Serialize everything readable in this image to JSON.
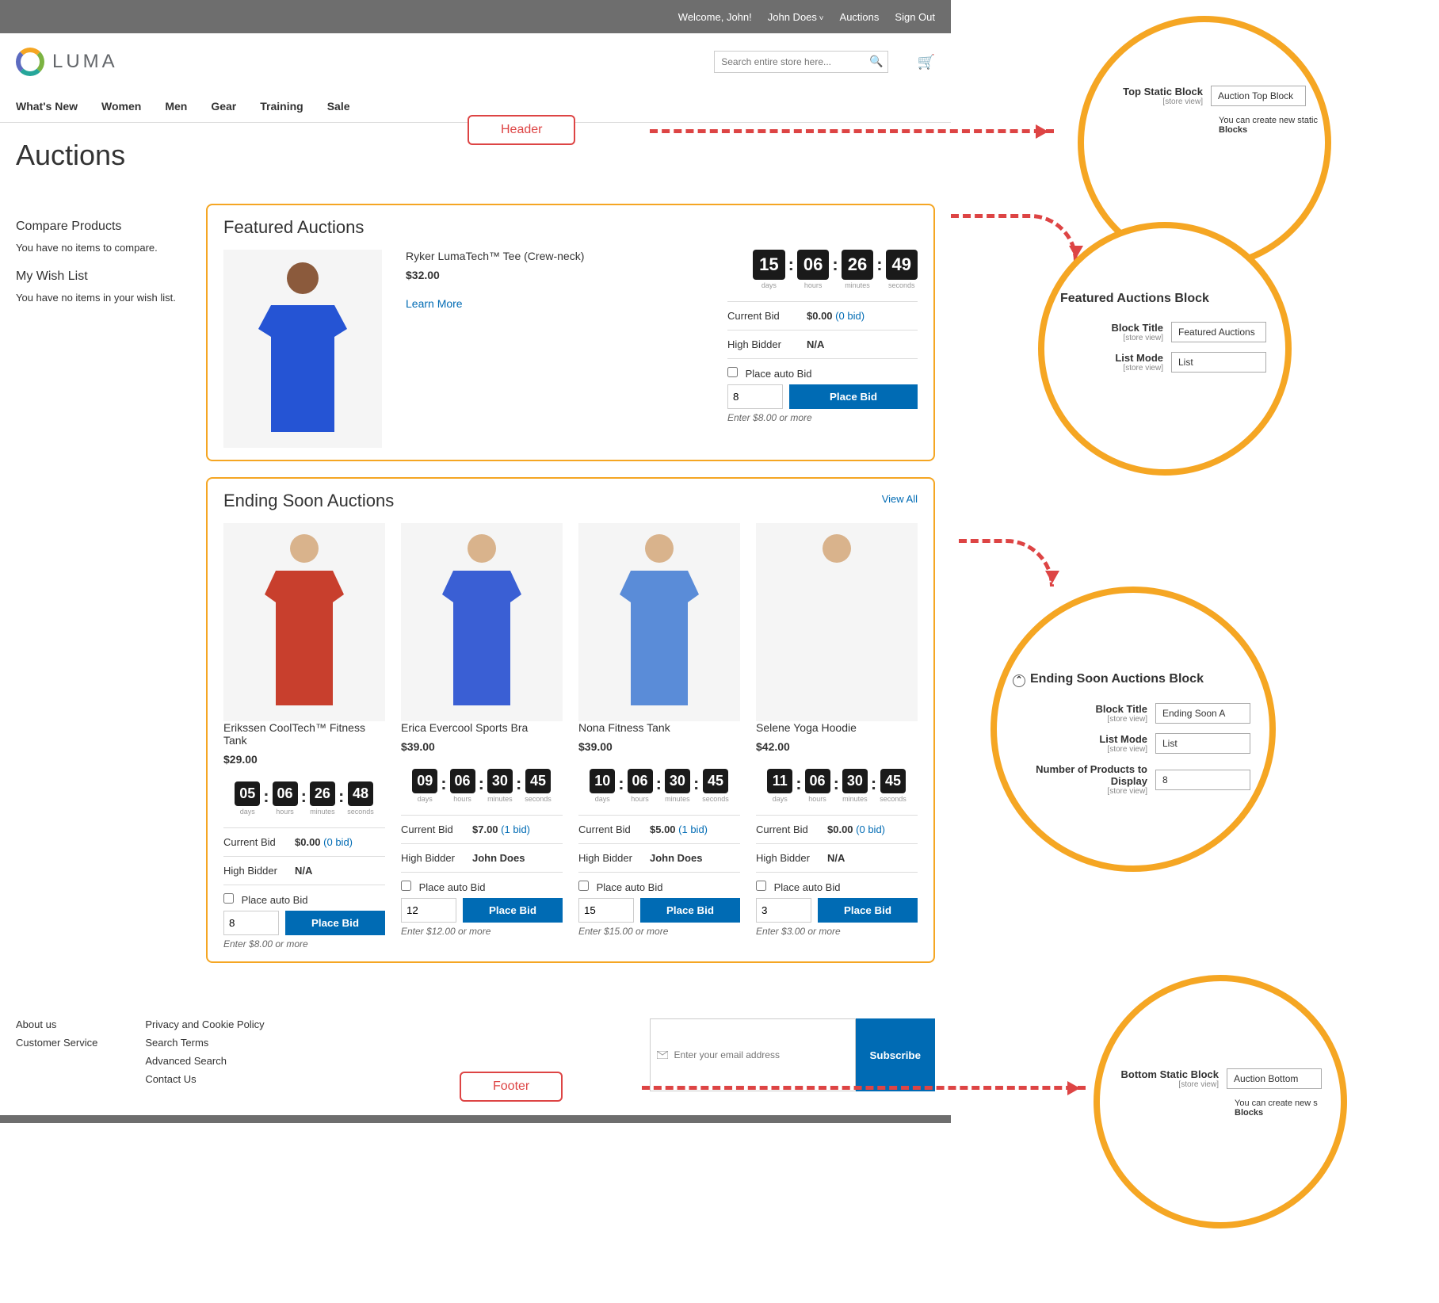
{
  "topbar": {
    "welcome": "Welcome, John!",
    "user": "John Does",
    "auctions": "Auctions",
    "signout": "Sign Out"
  },
  "logo": "LUMA",
  "search_placeholder": "Search entire store here...",
  "nav": [
    "What's New",
    "Women",
    "Men",
    "Gear",
    "Training",
    "Sale"
  ],
  "page_title": "Auctions",
  "sidebar": {
    "compare_title": "Compare Products",
    "compare_empty": "You have no items to compare.",
    "wishlist_title": "My Wish List",
    "wishlist_empty": "You have no items in your wish list."
  },
  "featured": {
    "title": "Featured Auctions",
    "item": {
      "name": "Ryker LumaTech™ Tee (Crew-neck)",
      "price": "$32.00",
      "learn": "Learn More",
      "countdown": {
        "days": "15",
        "hours": "06",
        "minutes": "26",
        "seconds": "49"
      },
      "current_bid_label": "Current Bid",
      "current_bid": "$0.00",
      "bid_count": "(0 bid)",
      "high_bidder_label": "High Bidder",
      "high_bidder": "N/A",
      "auto_bid_label": "Place auto Bid",
      "bid_value": "8",
      "place_bid": "Place Bid",
      "hint": "Enter $8.00 or more"
    }
  },
  "ending": {
    "title": "Ending Soon Auctions",
    "view_all": "View All",
    "items": [
      {
        "name": "Erikssen CoolTech™ Fitness Tank",
        "price": "$29.00",
        "countdown": {
          "days": "05",
          "hours": "06",
          "minutes": "26",
          "seconds": "48"
        },
        "current_bid": "$0.00",
        "bid_count": "(0 bid)",
        "high_bidder": "N/A",
        "bid_value": "8",
        "hint": "Enter $8.00 or more",
        "color": "#c83f2d"
      },
      {
        "name": "Erica Evercool Sports Bra",
        "price": "$39.00",
        "countdown": {
          "days": "09",
          "hours": "06",
          "minutes": "30",
          "seconds": "45"
        },
        "current_bid": "$7.00",
        "bid_count": "(1 bid)",
        "high_bidder": "John Does",
        "bid_value": "12",
        "hint": "Enter $12.00 or more",
        "color": "#3a5fd4"
      },
      {
        "name": "Nona Fitness Tank",
        "price": "$39.00",
        "countdown": {
          "days": "10",
          "hours": "06",
          "minutes": "30",
          "seconds": "45"
        },
        "current_bid": "$5.00",
        "bid_count": "(1 bid)",
        "high_bidder": "John Does",
        "bid_value": "15",
        "hint": "Enter $15.00 or more",
        "color": "#5a8cd8"
      },
      {
        "name": "Selene Yoga Hoodie",
        "price": "$42.00",
        "countdown": {
          "days": "11",
          "hours": "06",
          "minutes": "30",
          "seconds": "45"
        },
        "current_bid": "$0.00",
        "bid_count": "(0 bid)",
        "high_bidder": "N/A",
        "bid_value": "3",
        "hint": "Enter $3.00 or more",
        "color": "#f5f5f5"
      }
    ],
    "labels": {
      "current_bid": "Current Bid",
      "high_bidder": "High Bidder",
      "auto_bid": "Place auto Bid",
      "place_bid": "Place Bid"
    }
  },
  "cd_labels": {
    "days": "days",
    "hours": "hours",
    "minutes": "minutes",
    "seconds": "seconds"
  },
  "footer": {
    "col1": [
      "About us",
      "Customer Service"
    ],
    "col2": [
      "Privacy and Cookie Policy",
      "Search Terms",
      "Advanced Search",
      "Contact Us"
    ],
    "email_placeholder": "Enter your email address",
    "subscribe": "Subscribe"
  },
  "annotations": {
    "header_label": "Header",
    "footer_label": "Footer",
    "circle1": {
      "label": "Top Static Block",
      "sub": "[store view]",
      "value": "Auction Top Block",
      "note1": "You can create new static",
      "note2": "Blocks"
    },
    "circle2": {
      "title": "Featured Auctions Block",
      "row1_label": "Block Title",
      "row1_sub": "[store view]",
      "row1_value": "Featured Auctions",
      "row2_label": "List Mode",
      "row2_sub": "[store view]",
      "row2_value": "List"
    },
    "circle3": {
      "title": "Ending Soon Auctions Block",
      "row1_label": "Block Title",
      "row1_sub": "[store view]",
      "row1_value": "Ending Soon A",
      "row2_label": "List Mode",
      "row2_sub": "[store view]",
      "row2_value": "List",
      "row3_label": "Number of Products to Display",
      "row3_sub": "[store view]",
      "row3_value": "8"
    },
    "circle4": {
      "label": "Bottom Static Block",
      "sub": "[store view]",
      "value": "Auction Bottom",
      "note1": "You can create new s",
      "note2": "Blocks"
    }
  }
}
